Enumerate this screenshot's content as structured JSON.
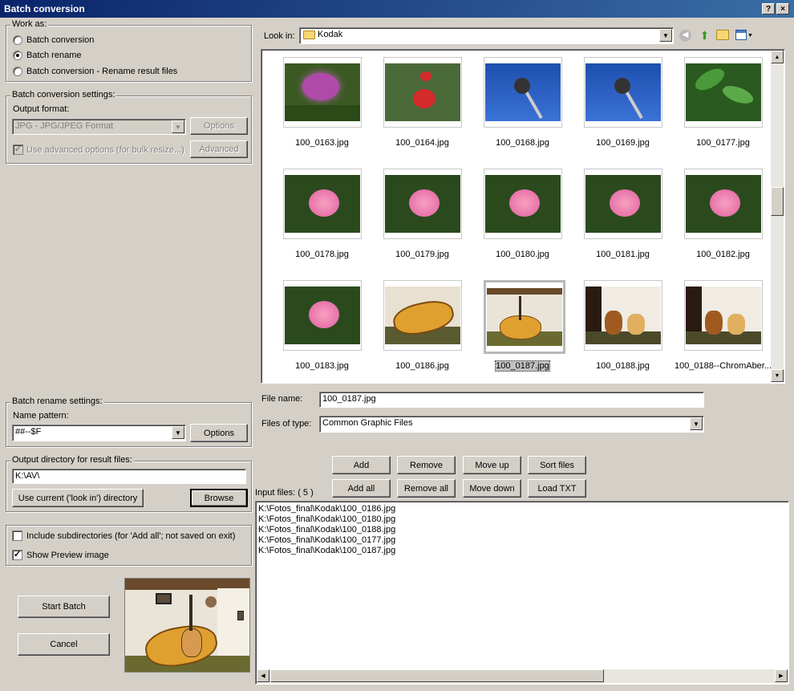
{
  "window": {
    "title": "Batch conversion",
    "help_btn": "?",
    "close_btn": "×"
  },
  "work_as": {
    "legend": "Work as:",
    "options": [
      {
        "label": "Batch conversion",
        "selected": false
      },
      {
        "label": "Batch rename",
        "selected": true
      },
      {
        "label": "Batch conversion - Rename result files",
        "selected": false
      }
    ]
  },
  "conversion_settings": {
    "legend": "Batch conversion settings:",
    "output_format_label": "Output format:",
    "output_format_value": "JPG - JPG/JPEG Format",
    "options_button": "Options",
    "advanced_checkbox_label": "Use advanced options (for bulk resize...)",
    "advanced_checked": true,
    "advanced_button": "Advanced"
  },
  "browser": {
    "look_in_label": "Look in:",
    "look_in_value": "Kodak",
    "thumbnails": [
      {
        "name": "100_0163.jpg",
        "kind": "flower-purple"
      },
      {
        "name": "100_0164.jpg",
        "kind": "flower-red"
      },
      {
        "name": "100_0168.jpg",
        "kind": "tower"
      },
      {
        "name": "100_0169.jpg",
        "kind": "tower"
      },
      {
        "name": "100_0177.jpg",
        "kind": "leaves"
      },
      {
        "name": "100_0178.jpg",
        "kind": "rose"
      },
      {
        "name": "100_0179.jpg",
        "kind": "rose"
      },
      {
        "name": "100_0180.jpg",
        "kind": "rose"
      },
      {
        "name": "100_0181.jpg",
        "kind": "rose"
      },
      {
        "name": "100_0182.jpg",
        "kind": "rose"
      },
      {
        "name": "100_0183.jpg",
        "kind": "rose"
      },
      {
        "name": "100_0186.jpg",
        "kind": "guitar-case"
      },
      {
        "name": "100_0187.jpg",
        "kind": "guitar-room",
        "selected": true
      },
      {
        "name": "100_0188.jpg",
        "kind": "guitar-dark"
      },
      {
        "name": "100_0188--ChromAber...",
        "kind": "guitar-dark"
      }
    ],
    "file_name_label": "File name:",
    "file_name_value": "100_0187.jpg",
    "files_of_type_label": "Files of type:",
    "files_of_type_value": "Common Graphic Files"
  },
  "rename_settings": {
    "legend": "Batch rename settings:",
    "name_pattern_label": "Name pattern:",
    "name_pattern_value": "##--$F",
    "options_button": "Options"
  },
  "output_dir": {
    "legend": "Output directory for result files:",
    "value": "K:\\AV\\",
    "use_current_button": "Use current ('look in') directory",
    "browse_button": "Browse"
  },
  "misc": {
    "include_subdirs_label": "Include subdirectories (for 'Add all'; not saved on exit)",
    "include_subdirs_checked": false,
    "show_preview_label": "Show Preview image",
    "show_preview_checked": true
  },
  "actions": {
    "start_batch": "Start Batch",
    "cancel": "Cancel"
  },
  "list_buttons": {
    "add": "Add",
    "remove": "Remove",
    "move_up": "Move up",
    "sort_files": "Sort files",
    "add_all": "Add all",
    "remove_all": "Remove all",
    "move_down": "Move down",
    "load_txt": "Load TXT"
  },
  "input_files": {
    "label": "Input files: ( 5 )",
    "items": [
      "K:\\Fotos_final\\Kodak\\100_0186.jpg",
      "K:\\Fotos_final\\Kodak\\100_0180.jpg",
      "K:\\Fotos_final\\Kodak\\100_0188.jpg",
      "K:\\Fotos_final\\Kodak\\100_0177.jpg",
      "K:\\Fotos_final\\Kodak\\100_0187.jpg"
    ]
  },
  "icons": [
    "folder-icon",
    "back-icon",
    "up-folder-icon",
    "new-folder-icon",
    "view-menu-icon"
  ]
}
